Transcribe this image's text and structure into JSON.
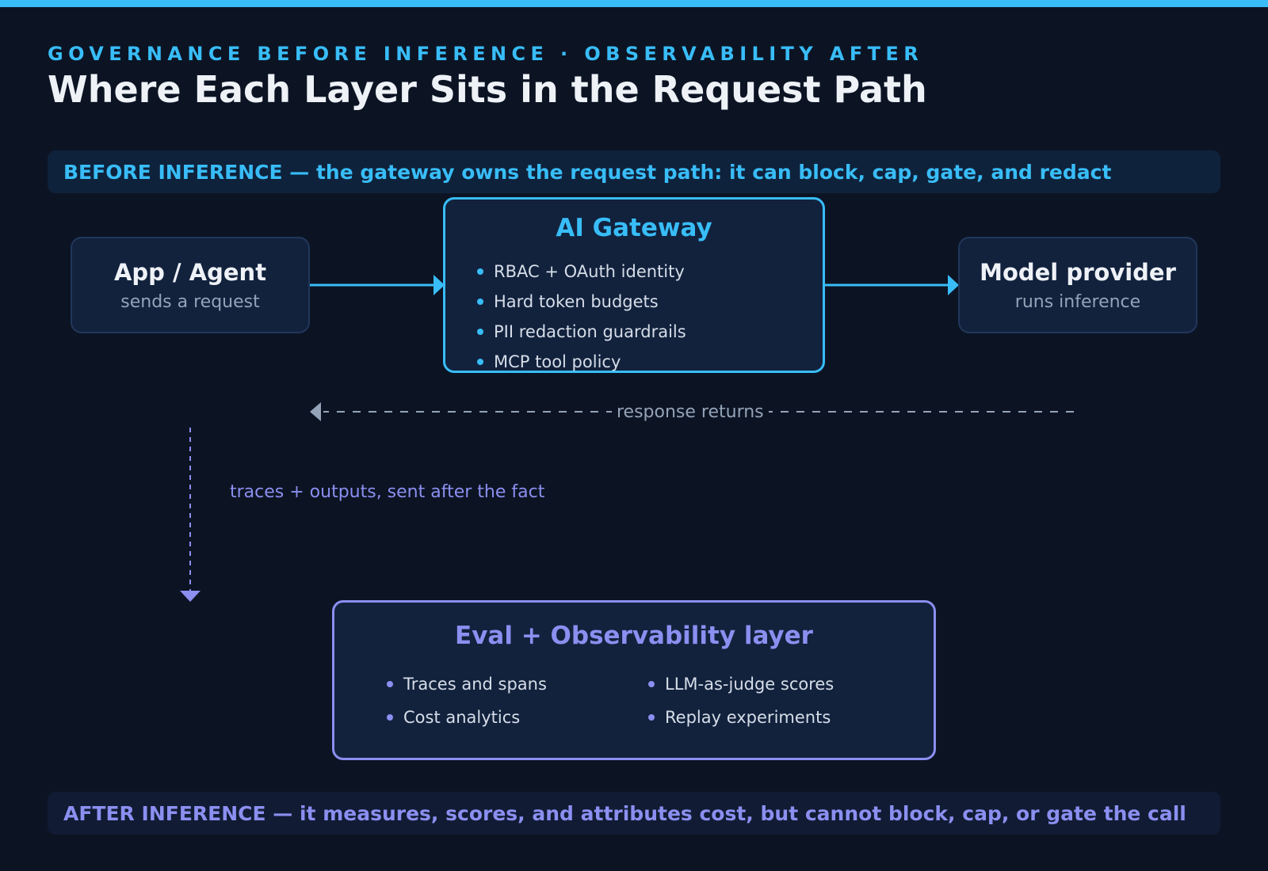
{
  "header": {
    "eyebrow": "GOVERNANCE BEFORE INFERENCE · OBSERVABILITY AFTER",
    "title": "Where Each Layer Sits in the Request Path"
  },
  "banners": {
    "before": "BEFORE INFERENCE — the gateway owns the request path: it can block, cap, gate, and redact",
    "after": "AFTER INFERENCE — it measures, scores, and attributes cost, but cannot block, cap, or gate the call"
  },
  "nodes": {
    "app": {
      "title": "App / Agent",
      "subtitle": "sends a request"
    },
    "gateway": {
      "title": "AI Gateway",
      "items": [
        "RBAC + OAuth identity",
        "Hard token budgets",
        "PII redaction guardrails",
        "MCP tool policy"
      ]
    },
    "provider": {
      "title": "Model provider",
      "subtitle": "runs inference"
    },
    "eval": {
      "title": "Eval + Observability layer",
      "items": [
        "Traces and spans",
        "Cost analytics",
        "LLM-as-judge scores",
        "Replay experiments"
      ]
    }
  },
  "edges": {
    "response": "response returns",
    "traces": "traces + outputs, sent after the fact"
  },
  "colors": {
    "background": "#0c1424",
    "gateway_accent": "#38bdf8",
    "eval_accent": "#8b8ff0",
    "box_fill": "#12223d",
    "muted_text": "#94a3b8"
  }
}
